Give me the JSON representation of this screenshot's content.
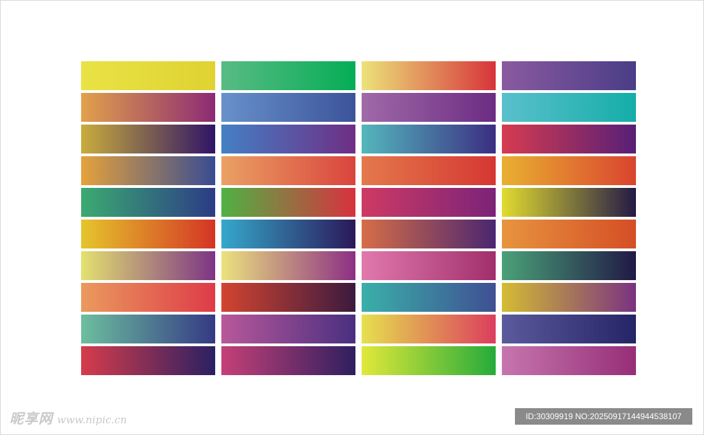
{
  "swatches": [
    [
      "#e9e345",
      "#dfd232"
    ],
    [
      "#59bb84",
      "#05ad56"
    ],
    [
      "#ece37a",
      "#d7343b"
    ],
    [
      "#8a5aa0",
      "#4a3d87"
    ],
    [
      "#e2a14b",
      "#8c2a74"
    ],
    [
      "#6891cb",
      "#3c5399"
    ],
    [
      "#a06aa8",
      "#6b2c82"
    ],
    [
      "#5ac0cb",
      "#15ada8"
    ],
    [
      "#c9ac3c",
      "#2f1467"
    ],
    [
      "#4480c5",
      "#6e2e84"
    ],
    [
      "#54b7bd",
      "#3b2e82"
    ],
    [
      "#d63b50",
      "#571f76"
    ],
    [
      "#e5a23c",
      "#384c92"
    ],
    [
      "#eaa164",
      "#d9443d"
    ],
    [
      "#e4794b",
      "#d53732"
    ],
    [
      "#e9b031",
      "#d9442f"
    ],
    [
      "#3bab71",
      "#2c3b86"
    ],
    [
      "#4fb244",
      "#d8313f"
    ],
    [
      "#ce3a64",
      "#7b2379"
    ],
    [
      "#e1db30",
      "#231a46"
    ],
    [
      "#e5c52c",
      "#d43525"
    ],
    [
      "#35a8cb",
      "#2b1859"
    ],
    [
      "#d66d48",
      "#4a2670"
    ],
    [
      "#e7943f",
      "#d44e25"
    ],
    [
      "#e4e170",
      "#7c3485"
    ],
    [
      "#ece27e",
      "#8c2f84"
    ],
    [
      "#e179ad",
      "#a02f6c"
    ],
    [
      "#4aa178",
      "#211945"
    ],
    [
      "#ea9a5e",
      "#de3b48"
    ],
    [
      "#d24430",
      "#3b1a3f"
    ],
    [
      "#3ab0a8",
      "#3f4f93"
    ],
    [
      "#d4bc33",
      "#7a3281"
    ],
    [
      "#6dbe9f",
      "#343a84"
    ],
    [
      "#b8589a",
      "#4a2f80"
    ],
    [
      "#e6e04e",
      "#dc3d5e"
    ],
    [
      "#5a5a9c",
      "#252466"
    ],
    [
      "#d63c4b",
      "#2a2062"
    ],
    [
      "#c54077",
      "#2e1f5f"
    ],
    [
      "#e1e83a",
      "#25ab3a"
    ],
    [
      "#c676ae",
      "#962e77"
    ]
  ],
  "watermark": {
    "logo": "昵享网",
    "url": "www.nipic.cn"
  },
  "image_id": "ID:30309919 NO:20250917144944538107"
}
